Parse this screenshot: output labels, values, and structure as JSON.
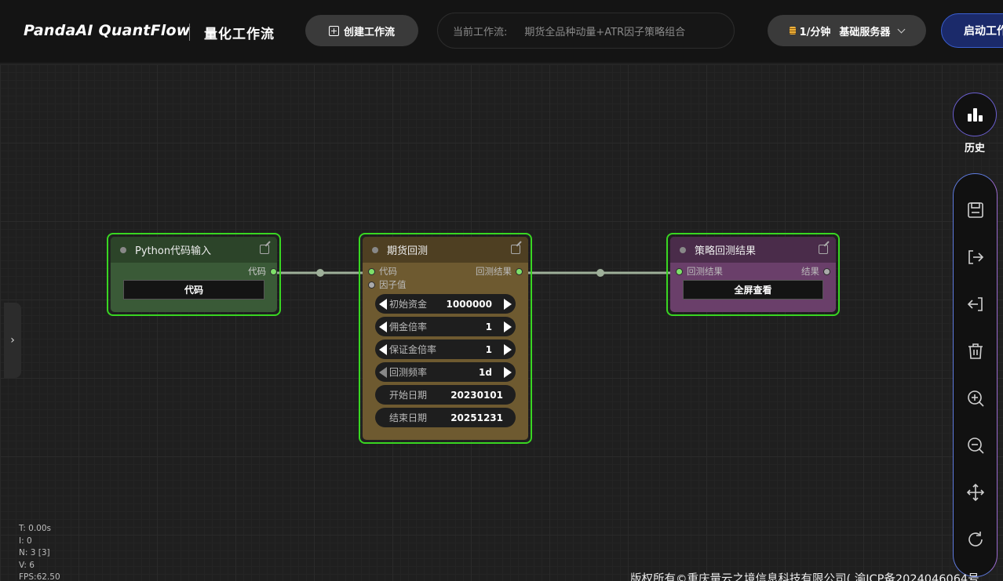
{
  "header": {
    "brand": "PandaAI QuantFlow",
    "subtitle": "量化工作流",
    "create_button": "创建工作流",
    "current_workflow_label": "当前工作流:",
    "current_workflow_name": "期货全品种动量+ATR因子策略组合",
    "server_rate": "1/分钟",
    "server_name": "基础服务器",
    "start_button": "启动工作流"
  },
  "nodes": {
    "python": {
      "title": "Python代码输入",
      "output": "代码",
      "button": "代码"
    },
    "backtest": {
      "title": "期货回测",
      "inputs": [
        "代码",
        "因子值"
      ],
      "output": "回测结果",
      "params": [
        {
          "label": "初始资金",
          "value": "1000000"
        },
        {
          "label": "佣金倍率",
          "value": "1"
        },
        {
          "label": "保证金倍率",
          "value": "1"
        },
        {
          "label": "回测频率",
          "value": "1d"
        },
        {
          "label": "开始日期",
          "value": "20230101"
        },
        {
          "label": "结束日期",
          "value": "20251231"
        }
      ]
    },
    "result": {
      "title": "策略回测结果",
      "input": "回测结果",
      "output": "结果",
      "button": "全屏查看"
    }
  },
  "toolbar": {
    "history_label": "历史",
    "tools": [
      "save-icon",
      "export-icon",
      "import-icon",
      "trash-icon",
      "zoom-in-icon",
      "zoom-out-icon",
      "move-icon",
      "refresh-icon"
    ]
  },
  "stats": {
    "t": "T: 0.00s",
    "i": "I: 0",
    "n": "N: 3 [3]",
    "v": "V: 6",
    "fps": "FPS:62.50"
  },
  "footer": "版权所有©重庆量云之境信息科技有限公司( 渝ICP备2024046064号",
  "colors": {
    "node_border": "#39d622",
    "python_node": "#3a5a37",
    "backtest_node": "#6e5a30",
    "result_node": "#6a3f6a",
    "start_button": "#1b2a6a"
  }
}
